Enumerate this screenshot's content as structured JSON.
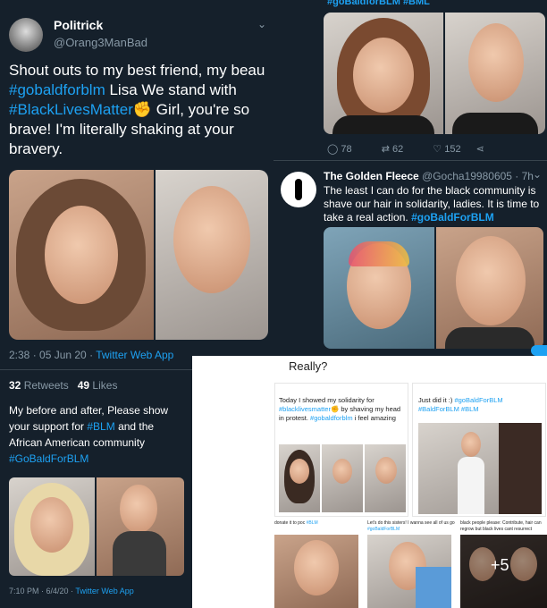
{
  "tweet1": {
    "display_name": "Politrick",
    "handle": "@Orang3ManBad",
    "text_a": "Shout outs to my best friend, my beau",
    "tag1": "#gobaldforblm",
    "text_b": " Lisa We stand with",
    "tag2": "#BlackLivesMatter",
    "text_c": " Girl, you're so brave! I'm literally shaking at your bravery.",
    "timestamp": "2:38 · 05 Jun 20 · ",
    "source": "Twitter Web App",
    "retweets_count": "32",
    "retweets_label": " Retweets",
    "likes_count": "49",
    "likes_label": " Likes"
  },
  "tweet2": {
    "top_tags": "#goBaldforBLM #BML",
    "replies": "78",
    "retweets": "62",
    "likes": "152"
  },
  "tweet3": {
    "display_name": "The Golden Fleece",
    "handle_time": " @Gocha19980605 · 7h",
    "text": "The least I can do for the black community is shave our hair in solidarity, ladies. It is time to take a real action. ",
    "tag": "#goBaldForBLM"
  },
  "tweet4": {
    "text_a": "My before and after, Please show your support for ",
    "tag1": "#BLM",
    "text_b": " and the African American community ",
    "tag2": "#GoBaldForBLM",
    "timestamp": "7:10 PM · 6/4/20 · ",
    "source": "Twitter Web App"
  },
  "collage": {
    "title": "Really?",
    "post1_a": "Today I showed my solidarity for ",
    "post1_tag": "#blacklivesmatter",
    "post1_b": " by shaving my head in protest. ",
    "post1_tag2": "#gobaldforblm",
    "post1_c": " i feel amazing",
    "post2_a": "Just did it :) ",
    "post2_tag": "#goBaldForBLM #BaldForBLM #BLM",
    "post3": "donate it to poc ",
    "post3_tag": "#BLM",
    "post4_a": "Let's do this sisters! I wanna see all of us go ",
    "post4_tag": "#goBaldForBLM",
    "post5": "black people please: Contribute, hair can regrow but black lives cant resurrect",
    "more": "+5"
  }
}
